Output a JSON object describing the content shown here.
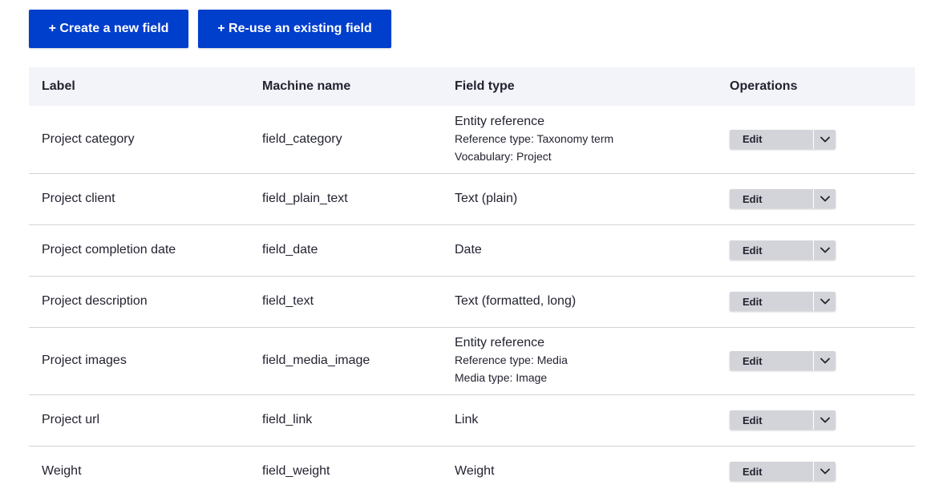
{
  "actions": {
    "create_label": "+ Create a new field",
    "reuse_label": "+ Re-use an existing field"
  },
  "table": {
    "headers": {
      "label": "Label",
      "machine_name": "Machine name",
      "field_type": "Field type",
      "operations": "Operations"
    },
    "rows": [
      {
        "label": "Project category",
        "machine_name": "field_category",
        "field_type": "Entity reference",
        "details": [
          "Reference type: Taxonomy term",
          "Vocabulary: Project"
        ],
        "edit_label": "Edit"
      },
      {
        "label": "Project client",
        "machine_name": "field_plain_text",
        "field_type": "Text (plain)",
        "details": [],
        "edit_label": "Edit"
      },
      {
        "label": "Project completion date",
        "machine_name": "field_date",
        "field_type": "Date",
        "details": [],
        "edit_label": "Edit"
      },
      {
        "label": "Project description",
        "machine_name": "field_text",
        "field_type": "Text (formatted, long)",
        "details": [],
        "edit_label": "Edit"
      },
      {
        "label": "Project images",
        "machine_name": "field_media_image",
        "field_type": "Entity reference",
        "details": [
          "Reference type: Media",
          "Media type: Image"
        ],
        "edit_label": "Edit"
      },
      {
        "label": "Project url",
        "machine_name": "field_link",
        "field_type": "Link",
        "details": [],
        "edit_label": "Edit"
      },
      {
        "label": "Weight",
        "machine_name": "field_weight",
        "field_type": "Weight",
        "details": [],
        "edit_label": "Edit"
      }
    ]
  },
  "icons": {
    "dropdown": "chevron-down-icon"
  },
  "colors": {
    "primary": "#003ecc",
    "header_bg": "#f3f4f9",
    "dropbutton_bg": "#d3d4d9"
  }
}
